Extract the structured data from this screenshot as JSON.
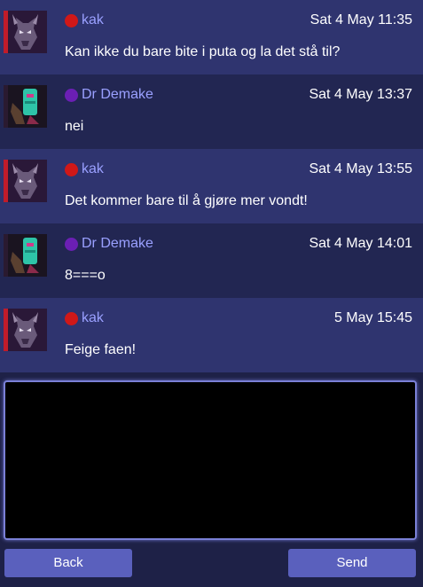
{
  "messages": [
    {
      "author": "kak",
      "status_color": "#d01818",
      "avatar": "demon-avatar-icon",
      "timestamp": "Sat 4 May 11:35",
      "text": "Kan ikke du bare bite i puta og la det stå til?"
    },
    {
      "author": "Dr Demake",
      "status_color": "#6b1fb4",
      "avatar": "robot-avatar-icon",
      "timestamp": "Sat 4 May 13:37",
      "text": "nei"
    },
    {
      "author": "kak",
      "status_color": "#d01818",
      "avatar": "demon-avatar-icon",
      "timestamp": "Sat 4 May 13:55",
      "text": "Det kommer bare til å gjøre mer vondt!"
    },
    {
      "author": "Dr Demake",
      "status_color": "#6b1fb4",
      "avatar": "robot-avatar-icon",
      "timestamp": "Sat 4 May 14:01",
      "text": "8===o"
    },
    {
      "author": "kak",
      "status_color": "#d01818",
      "avatar": "demon-avatar-icon",
      "timestamp": "5 May 15:45",
      "text": "Feige faen!"
    }
  ],
  "compose": {
    "value": ""
  },
  "buttons": {
    "back": "Back",
    "send": "Send"
  }
}
